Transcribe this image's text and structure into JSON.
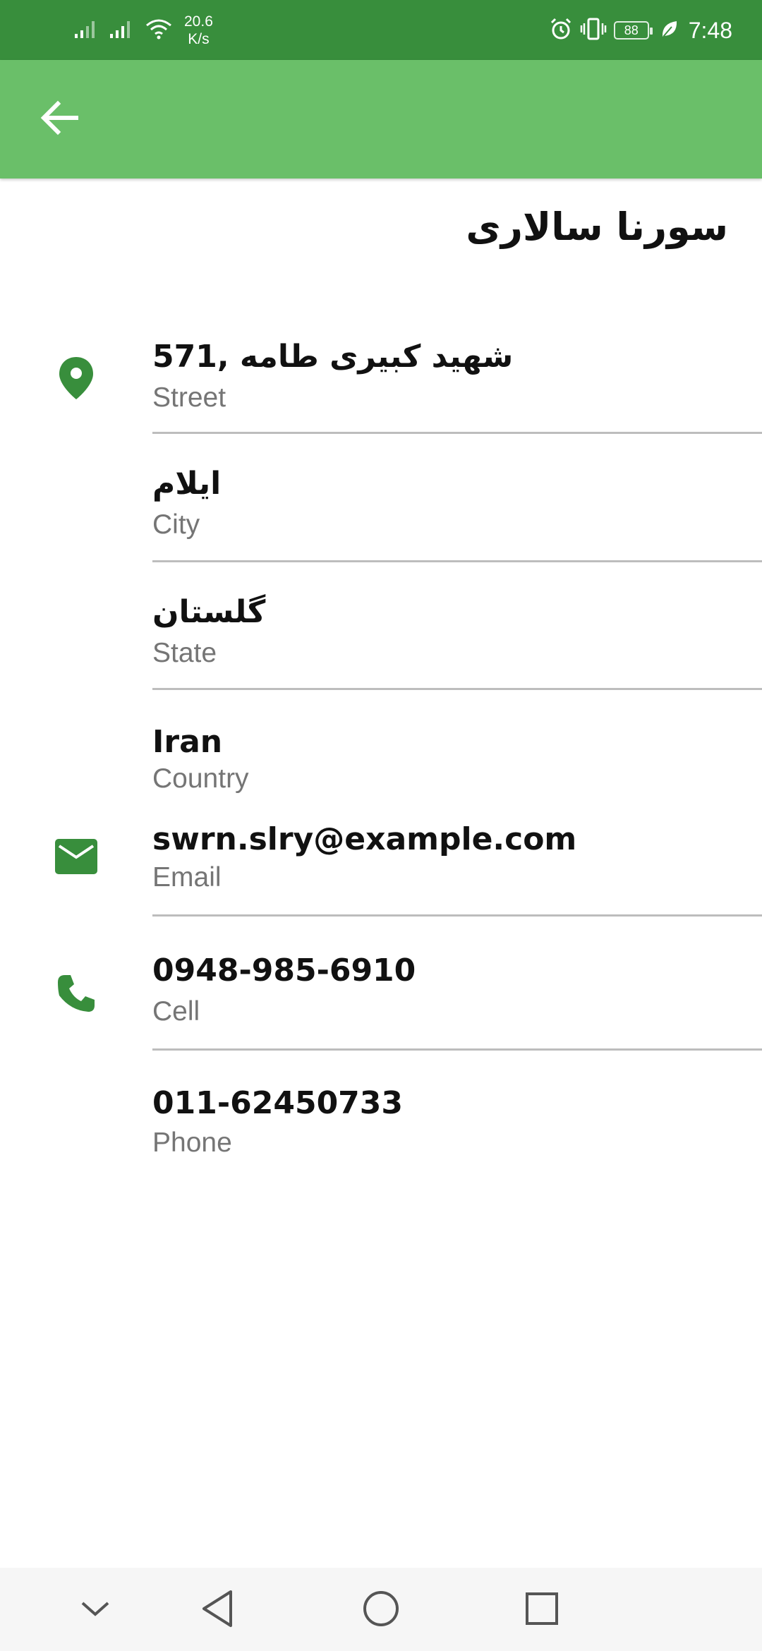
{
  "status_bar": {
    "network_speed_value": "20.6",
    "network_speed_unit": "K/s",
    "battery": "88",
    "time": "7:48"
  },
  "app_bar": {
    "back_icon": "arrow-back-icon"
  },
  "contact": {
    "name": "سورنا سالاری"
  },
  "details": [
    {
      "value": "571, شهید کبیری طامه",
      "label": "Street",
      "icon": "location-pin-icon"
    },
    {
      "value": "ایلام",
      "label": "City"
    },
    {
      "value": "گلستان",
      "label": "State"
    },
    {
      "value": "Iran",
      "label": "Country"
    },
    {
      "value": "swrn.slry@example.com",
      "label": "Email",
      "icon": "email-icon"
    },
    {
      "value": "0948-985-6910",
      "label": "Cell",
      "icon": "phone-icon"
    },
    {
      "value": "011-62450733",
      "label": "Phone"
    }
  ],
  "colors": {
    "status_bar": "#388e3c",
    "app_bar": "#6abf69",
    "icon_accent": "#388e3c"
  },
  "nav_bar": {
    "icons": [
      "chevron-down-icon",
      "back-triangle-icon",
      "home-circle-icon",
      "recents-square-icon"
    ]
  }
}
